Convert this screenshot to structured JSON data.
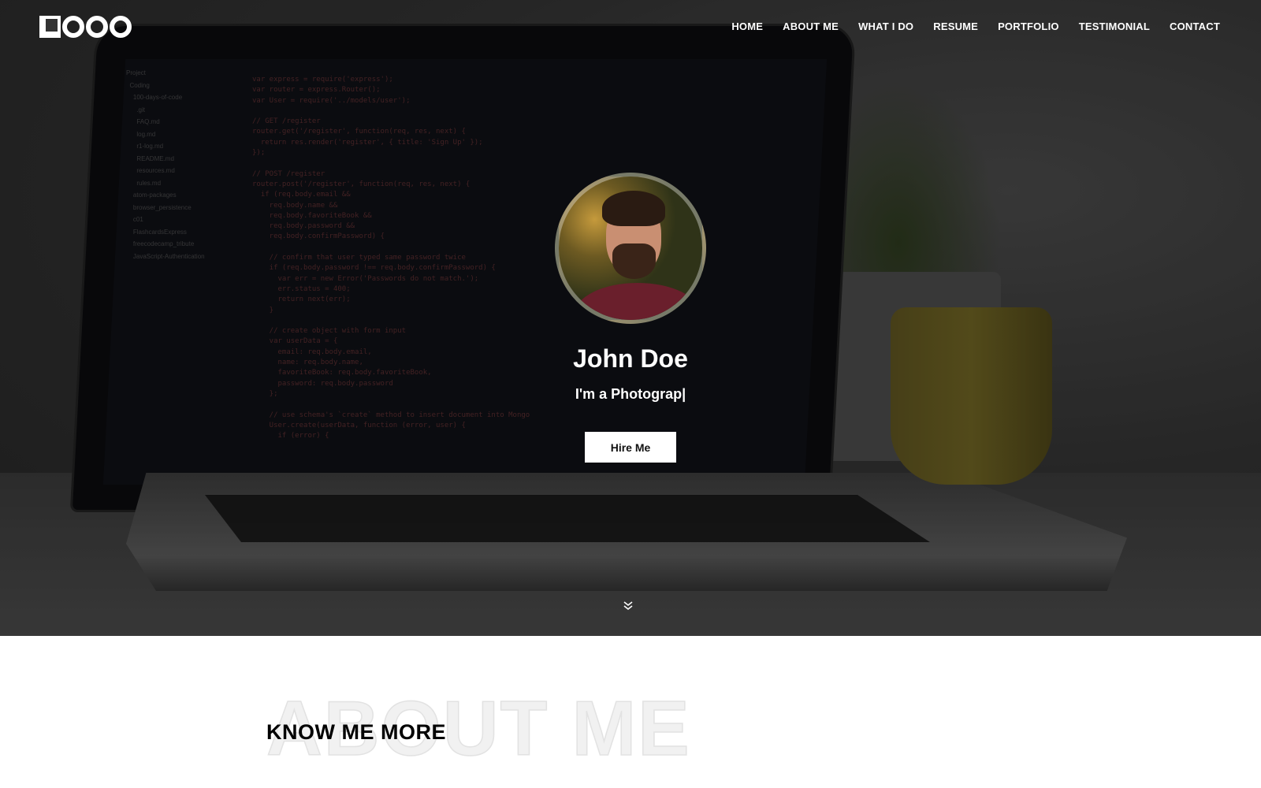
{
  "brand": {
    "logo_text": "LOGO"
  },
  "nav": {
    "items": [
      "HOME",
      "ABOUT ME",
      "WHAT I DO",
      "RESUME",
      "PORTFOLIO",
      "TESTIMONIAL",
      "CONTACT"
    ]
  },
  "hero": {
    "name": "John Doe",
    "subtitle": "I'm a Photograp|",
    "cta": "Hire Me",
    "scroll_icon": "double-chevron-down-icon"
  },
  "about": {
    "background_title": "ABOUT ME",
    "title": "KNOW ME MORE"
  }
}
